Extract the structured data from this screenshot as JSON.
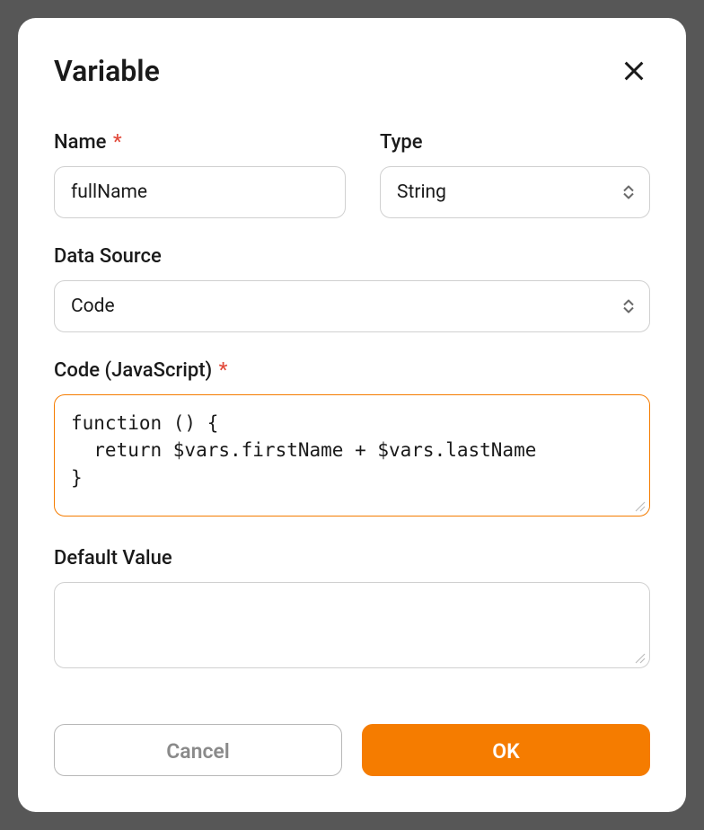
{
  "dialog": {
    "title": "Variable"
  },
  "labels": {
    "name": "Name",
    "type": "Type",
    "dataSource": "Data Source",
    "code": "Code (JavaScript)",
    "defaultValue": "Default Value"
  },
  "values": {
    "name": "fullName",
    "type": "String",
    "dataSource": "Code",
    "code": "function () {\n  return $vars.firstName + $vars.lastName\n}",
    "defaultValue": ""
  },
  "buttons": {
    "cancel": "Cancel",
    "ok": "OK"
  },
  "colors": {
    "accent": "#F57C00",
    "requiredAsterisk": "#e24a3b"
  }
}
